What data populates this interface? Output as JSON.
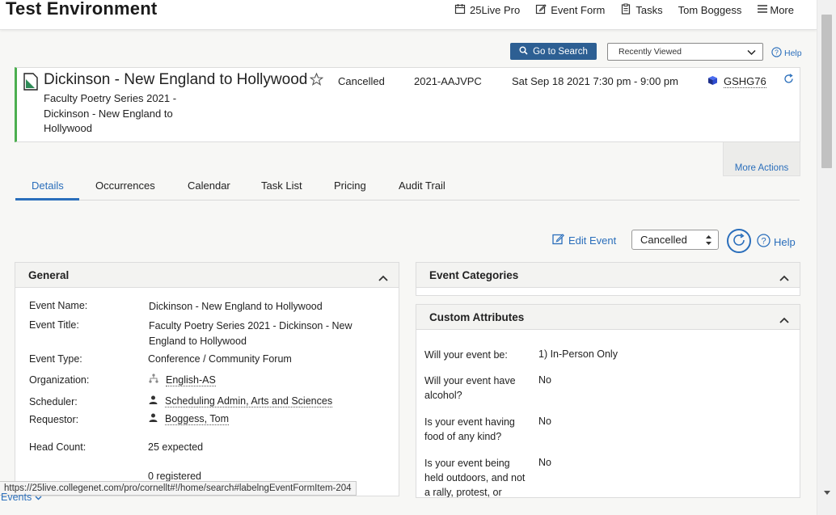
{
  "app": {
    "env_title": "Test Environment",
    "nav": [
      {
        "label": "25Live Pro",
        "icon": "calendar-icon"
      },
      {
        "label": "Event Form",
        "icon": "edit-icon"
      },
      {
        "label": "Tasks",
        "icon": "clipboard-icon"
      },
      {
        "label": "Tom Boggess",
        "icon": ""
      },
      {
        "label": "More",
        "icon": "hamburger-icon"
      }
    ]
  },
  "search": {
    "goto_label": "Go to Search",
    "recent_value": "Recently Viewed",
    "help_label": "Help"
  },
  "event": {
    "name": "Dickinson - New England to Hollywood",
    "status": "Cancelled",
    "reference": "2021-AAJVPC",
    "datetime": "Sat Sep 18 2021 7:30 pm - 9:00 pm",
    "code": "GSHG76",
    "subtitle": "Faculty Poetry Series 2021 - Dickinson - New England to Hollywood",
    "more_actions": "More Actions",
    "accent_color": "#4caf50"
  },
  "tabs": [
    "Details",
    "Occurrences",
    "Calendar",
    "Task List",
    "Pricing",
    "Audit Trail"
  ],
  "actions": {
    "edit_label": "Edit Event",
    "state_value": "Cancelled",
    "help_label": "Help"
  },
  "general": {
    "title": "General",
    "rows": {
      "event_name": {
        "label": "Event Name:",
        "value": "Dickinson - New England to Hollywood"
      },
      "event_title": {
        "label": "Event Title:",
        "value": "Faculty Poetry Series 2021 - Dickinson - New England to Hollywood"
      },
      "event_type": {
        "label": "Event Type:",
        "value": "Conference / Community Forum"
      },
      "organization": {
        "label": "Organization:",
        "value": "English-AS"
      },
      "scheduler": {
        "label": "Scheduler:",
        "value": "Scheduling Admin, Arts and Sciences"
      },
      "requestor": {
        "label": "Requestor:",
        "value": "Boggess, Tom"
      },
      "head_count": {
        "label": "Head Count:",
        "value": "25 expected",
        "registered": "0 registered"
      }
    }
  },
  "categories": {
    "title": "Event Categories"
  },
  "custom": {
    "title": "Custom Attributes",
    "rows": [
      {
        "label": "Will your event be:",
        "value": "1) In-Person Only"
      },
      {
        "label": "Will your event have alcohol?",
        "value": "No"
      },
      {
        "label": "Is your event having food of any kind?",
        "value": "No"
      },
      {
        "label": "Is your event being held outdoors, and not a rally, protest, or",
        "value": "No"
      }
    ]
  },
  "status_bar": {
    "url": "https://25live.collegenet.com/pro/cornellt#!/home/search#labelngEventFormItem-204",
    "events_label": "Events"
  },
  "colors": {
    "accent": "#2a6ebb",
    "primary_button": "#2d5f93"
  }
}
